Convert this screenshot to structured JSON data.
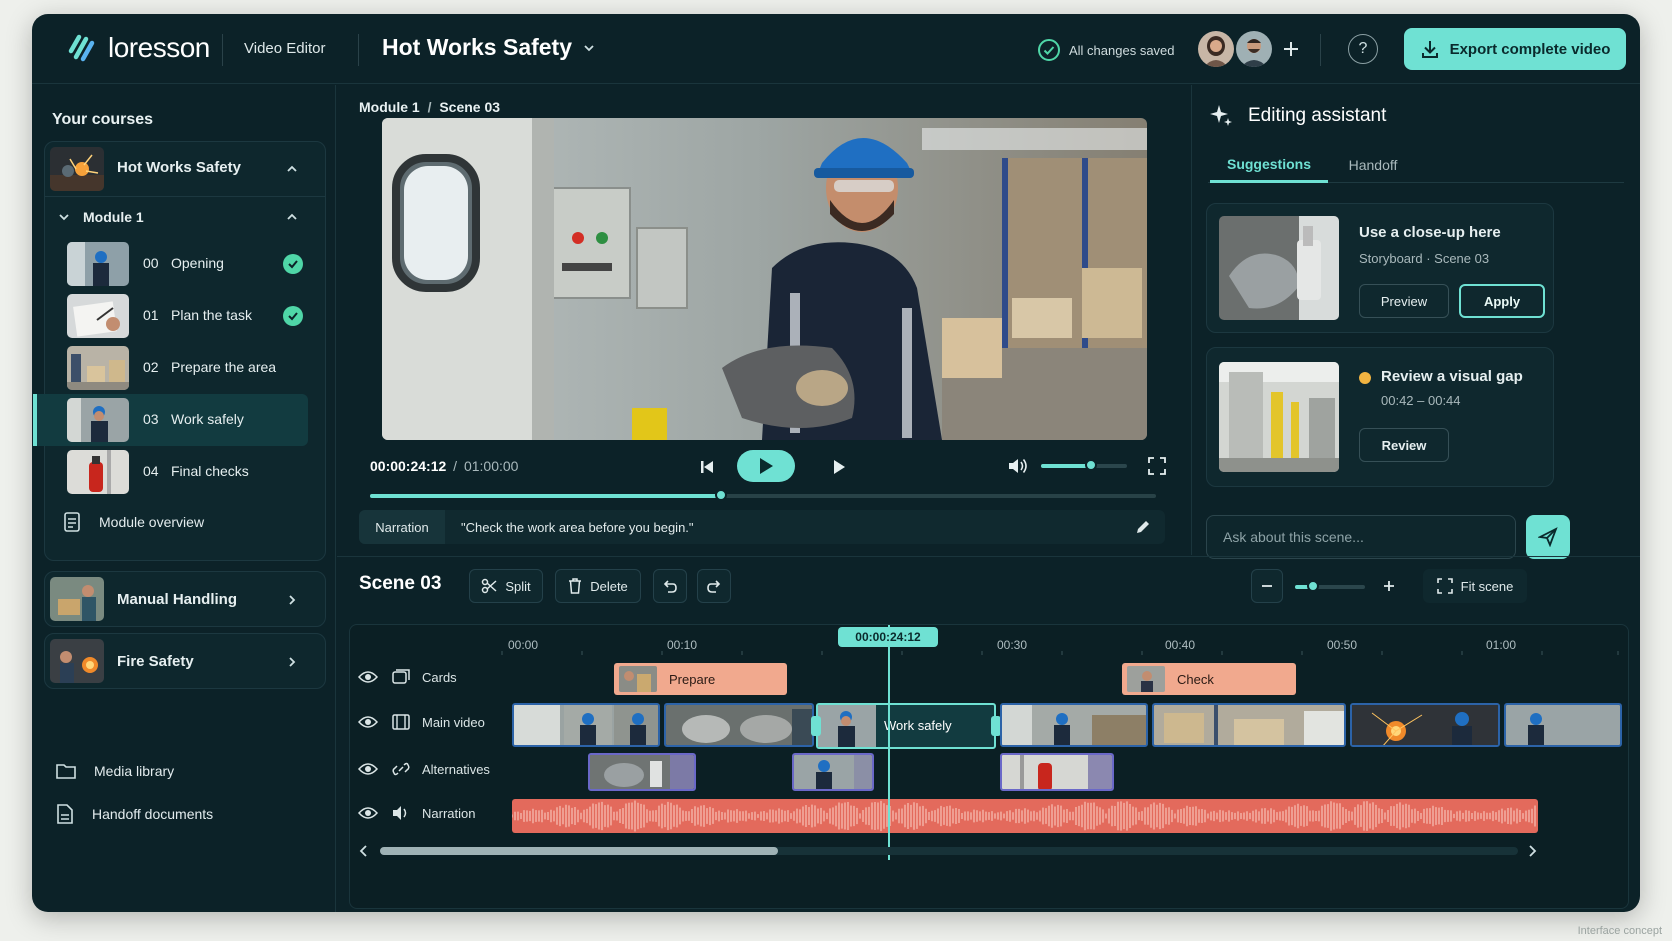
{
  "app": {
    "logo": "loresson",
    "section": "Video Editor",
    "project_title": "Hot Works Safety",
    "saved_status": "All changes saved",
    "export_label": "Export complete video",
    "accent": "#6fe1d3"
  },
  "sidebar": {
    "title": "Your courses",
    "course": {
      "name": "Hot Works Safety"
    },
    "module": {
      "name": "Module 1"
    },
    "scenes": [
      {
        "num": "00",
        "label": "Opening",
        "done": true
      },
      {
        "num": "01",
        "label": "Plan the task",
        "done": true
      },
      {
        "num": "02",
        "label": "Prepare the area",
        "done": false
      },
      {
        "num": "03",
        "label": "Work safely",
        "done": false,
        "active": true
      },
      {
        "num": "04",
        "label": "Final checks",
        "done": false
      }
    ],
    "module_overview": "Module overview",
    "other_courses": [
      {
        "name": "Manual Handling"
      },
      {
        "name": "Fire Safety"
      }
    ],
    "media_library": "Media library",
    "handoff_documents": "Handoff documents"
  },
  "player": {
    "breadcrumb_module": "Module 1",
    "breadcrumb_sep": "/",
    "breadcrumb_scene": "Scene 03",
    "current_time": "00:00:24:12",
    "time_sep": "/",
    "total_time": "01:00:00",
    "progress": 0.447,
    "volume": 0.58,
    "narration_tag": "Narration",
    "narration_text": "\"Check the work area before you begin.\""
  },
  "assistant": {
    "title": "Editing assistant",
    "tabs": [
      "Suggestions",
      "Handoff"
    ],
    "active_tab": "Suggestions",
    "suggestions": [
      {
        "title": "Use a close-up here",
        "subtitle": "Storyboard · Scene 03",
        "preview_label": "Preview",
        "apply_label": "Apply"
      },
      {
        "title": "Review a visual gap",
        "subtitle": "00:42 – 00:44",
        "review_label": "Review",
        "status_color": "#f2b441"
      }
    ],
    "ask_placeholder": "Ask about this scene..."
  },
  "timeline": {
    "title": "Scene 03",
    "split_label": "Split",
    "delete_label": "Delete",
    "fit_label": "Fit scene",
    "zoom": 0.25,
    "ruler": [
      "00:00",
      "00:10",
      "00:30",
      "00:40",
      "00:50",
      "01:00"
    ],
    "playhead_label": "00:00:24:12",
    "tracks": [
      {
        "label": "Cards",
        "icon": "cards-icon"
      },
      {
        "label": "Main video",
        "icon": "film-icon"
      },
      {
        "label": "Alternatives",
        "icon": "link-icon"
      },
      {
        "label": "Narration",
        "icon": "speaker-icon"
      }
    ],
    "cards": [
      {
        "label": "Prepare"
      },
      {
        "label": "Check"
      }
    ],
    "selected_clip": "Work safely"
  },
  "footer_note": "Interface concept"
}
